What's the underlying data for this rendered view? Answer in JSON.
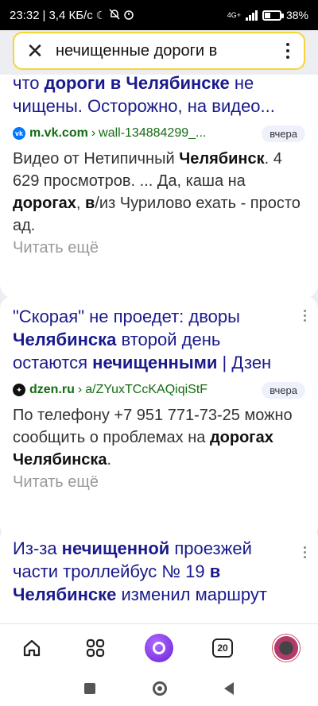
{
  "status_bar": {
    "time": "23:32",
    "speed": "3,4 КБ/с",
    "network": "4G+",
    "battery_percent": "38%",
    "battery_level": 0.38
  },
  "search": {
    "query": "нечищенные дороги в"
  },
  "results": [
    {
      "title_parts": [
        {
          "t": "что ",
          "b": false
        },
        {
          "t": "дороги в Челябинске",
          "b": true
        },
        {
          "t": " не чищены. Осторожно, на видео...",
          "b": false
        }
      ],
      "source_domain": "m.vk.com",
      "source_path": "wall-134884299_...",
      "source_icon": "vk-icon",
      "date": "вчера",
      "snippet_parts": [
        {
          "t": "Видео от Нетипичный ",
          "b": false
        },
        {
          "t": "Челябинск",
          "b": true
        },
        {
          "t": ". 4 629 просмотров. ... Да, каша на ",
          "b": false
        },
        {
          "t": "дорогах",
          "b": true
        },
        {
          "t": ", ",
          "b": false
        },
        {
          "t": "в",
          "b": true
        },
        {
          "t": "/из Чурилово ехать - просто ад.",
          "b": false
        }
      ],
      "read_more": "Читать ещё"
    },
    {
      "title_parts": [
        {
          "t": "\"Скорая\" не проедет: дворы ",
          "b": false
        },
        {
          "t": "Челябинска",
          "b": true
        },
        {
          "t": " второй день остаются ",
          "b": false
        },
        {
          "t": "нечищенными",
          "b": true
        },
        {
          "t": " | Дзен",
          "b": false
        }
      ],
      "source_domain": "dzen.ru",
      "source_path": "a/ZYuxTCcKAQiqiStF",
      "source_icon": "dzen-icon",
      "date": "вчера",
      "snippet_parts": [
        {
          "t": "По телефону +7 951 771-73-25 можно сообщить о проблемах на ",
          "b": false
        },
        {
          "t": "дорогах Челябинска",
          "b": true
        },
        {
          "t": ".",
          "b": false
        }
      ],
      "read_more": "Читать ещё"
    },
    {
      "title_parts": [
        {
          "t": "Из-за ",
          "b": false
        },
        {
          "t": "нечищенной",
          "b": true
        },
        {
          "t": " проезжей части троллейбус № 19 ",
          "b": false
        },
        {
          "t": "в Челябинске",
          "b": true
        },
        {
          "t": " изменил маршрут",
          "b": false
        }
      ]
    }
  ],
  "bottom_nav": {
    "tabs_count": "20",
    "items": [
      "home-icon",
      "services-grid-icon",
      "alice-icon",
      "tabs-icon",
      "profile-avatar"
    ]
  },
  "colors": {
    "search_border": "#f5d43a",
    "title": "#1a1a8c",
    "url": "#136c13",
    "alice": "#7c2ff0"
  }
}
